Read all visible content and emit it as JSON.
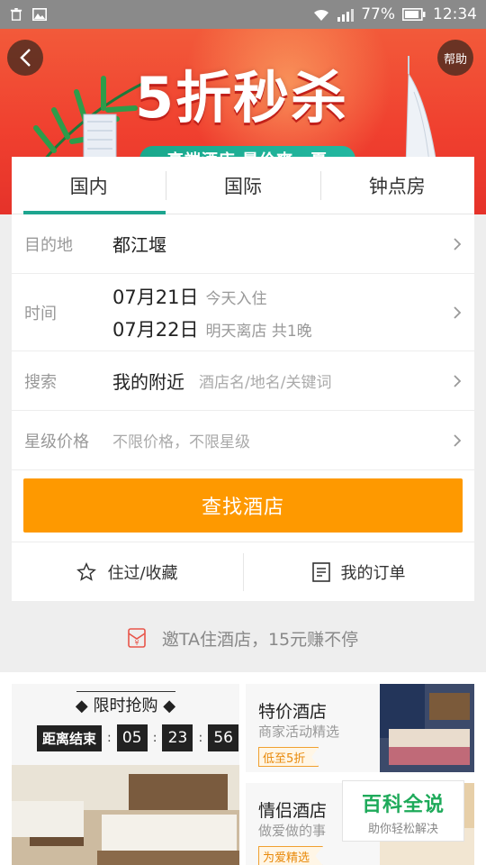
{
  "status_bar": {
    "battery": "77%",
    "time": "12:34"
  },
  "banner": {
    "title": "5折秒杀",
    "subtitle": "高端酒店 暑价爽一夏",
    "help": "帮助"
  },
  "tabs": [
    {
      "label": "国内",
      "active": true
    },
    {
      "label": "国际",
      "active": false
    },
    {
      "label": "钟点房",
      "active": false
    }
  ],
  "form": {
    "destination": {
      "label": "目的地",
      "value": "都江堰"
    },
    "time": {
      "label": "时间",
      "checkin_date": "07月21日",
      "checkin_note": "今天入住",
      "checkout_date": "07月22日",
      "checkout_note": "明天离店 共1晚"
    },
    "search": {
      "label": "搜索",
      "value": "我的附近",
      "placeholder": "酒店名/地名/关键词"
    },
    "star_price": {
      "label": "星级价格",
      "value": "不限价格，不限星级"
    }
  },
  "search_button": "查找酒店",
  "bottom_links": {
    "favorites": "住过/收藏",
    "orders": "我的订单"
  },
  "invite": "邀TA住酒店，15元赚不停",
  "flash_sale": {
    "title": "限时抢购",
    "end_label": "距离结束",
    "hours": "05",
    "minutes": "23",
    "seconds": "56"
  },
  "deals": [
    {
      "title": "特价酒店",
      "desc": "商家活动精选",
      "tag": "低至5折"
    },
    {
      "title": "情侣酒店",
      "desc": "做爱做的事",
      "tag": "为爱精选"
    }
  ],
  "watermark": {
    "big": "百科全说",
    "small": "助你轻松解决"
  },
  "colors": {
    "accent": "#1ea58f",
    "button": "#fe9900",
    "banner": "#f0402f"
  }
}
